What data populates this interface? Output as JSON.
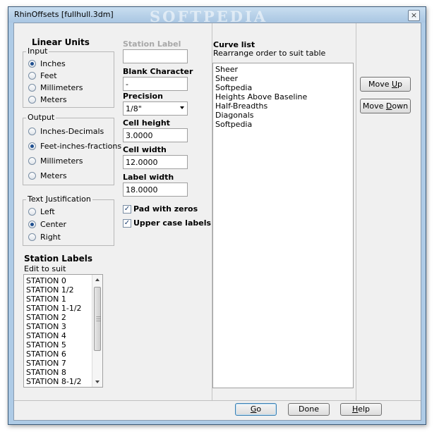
{
  "window": {
    "title": "RhinOffsets [fullhull.3dm]",
    "watermark": "SOFTPEDIA",
    "close_glyph": "×"
  },
  "linear_units": {
    "heading": "Linear Units",
    "input": {
      "legend": "Input",
      "options": [
        {
          "label": "Inches",
          "checked": true
        },
        {
          "label": "Feet",
          "checked": false
        },
        {
          "label": "Millimeters",
          "checked": false
        },
        {
          "label": "Meters",
          "checked": false
        }
      ]
    },
    "output": {
      "legend": "Output",
      "options": [
        {
          "label": "Inches-Decimals",
          "checked": false
        },
        {
          "label": "Feet-inches-fractions",
          "checked": true
        },
        {
          "label": "Millimeters",
          "checked": false
        },
        {
          "label": "Meters",
          "checked": false
        }
      ]
    }
  },
  "text_justification": {
    "legend": "Text Justification",
    "options": [
      {
        "label": "Left",
        "checked": false
      },
      {
        "label": "Center",
        "checked": true
      },
      {
        "label": "Right",
        "checked": false
      }
    ]
  },
  "station_labels": {
    "heading": "Station Labels",
    "subheading": "Edit to suit",
    "items": [
      "STATION 0",
      "STATION 1/2",
      "STATION 1",
      "STATION 1-1/2",
      "STATION 2",
      "STATION 3",
      "STATION 4",
      "STATION 5",
      "STATION 6",
      "STATION 7",
      "STATION 8",
      "STATION 8-1/2"
    ]
  },
  "fields": {
    "station_label": {
      "label": "Station Label",
      "value": ""
    },
    "blank_character": {
      "label": "Blank Character",
      "value": "-"
    },
    "precision": {
      "label": "Precision",
      "value": "1/8\""
    },
    "cell_height": {
      "label": "Cell height",
      "value": "3.0000"
    },
    "cell_width": {
      "label": "Cell width",
      "value": "12.0000"
    },
    "label_width": {
      "label": "Label width",
      "value": "18.0000"
    }
  },
  "checkboxes": {
    "pad_with_zeros": {
      "label": "Pad with zeros",
      "checked": true
    },
    "upper_case_labels": {
      "label": "Upper case labels",
      "checked": true
    }
  },
  "curve_list": {
    "heading": "Curve list",
    "subheading": "Rearrange order to suit table",
    "items": [
      "Sheer",
      "Sheer",
      "Softpedia",
      "Heights Above Baseline",
      "Half-Breadths",
      "Diagonals",
      "Softpedia"
    ]
  },
  "buttons": {
    "move_up": {
      "pre": "Move ",
      "key": "U",
      "post": "p"
    },
    "move_down": {
      "pre": "Move ",
      "key": "D",
      "post": "own"
    },
    "go": {
      "pre": "",
      "key": "G",
      "post": "o"
    },
    "done": {
      "label": "Done"
    },
    "help": {
      "pre": "",
      "key": "H",
      "post": "elp"
    }
  },
  "check_glyph": "✓"
}
